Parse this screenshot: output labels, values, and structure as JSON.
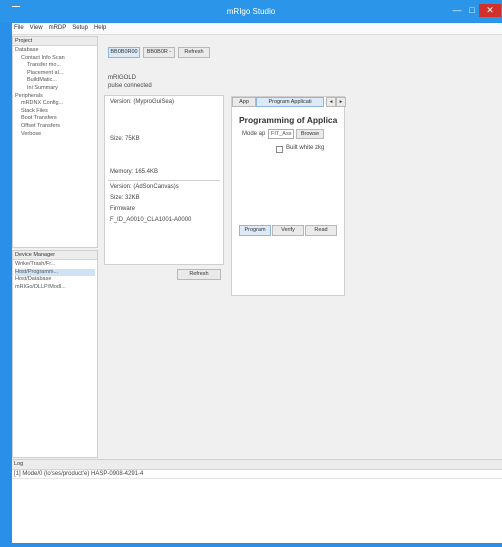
{
  "window": {
    "title": "mRIgo Studio"
  },
  "menubar": {
    "items": [
      "File",
      "View",
      "mRDP",
      "Setup",
      "Help"
    ]
  },
  "sidebar": {
    "header": "Project",
    "items": [
      "Database",
      "Contact Info Scan",
      "Transfer mo...",
      "Placement al...",
      "BuildMatic...",
      "Ini Summary",
      "Peripherals",
      "mRDNX Config...",
      "Stack Files",
      "Boot Transfers",
      "Offset Transfers",
      "Verbose"
    ]
  },
  "devlist": {
    "header": "Device Manager",
    "items": [
      "Wrike/Trash/Fr...",
      "Host/Programm...",
      "Host/Database",
      "mRIGo/DLLP/Modl..."
    ]
  },
  "toolbar": {
    "tab_label": "BB0B0R00",
    "tab2_label": "BB0B0R -",
    "refresh_label": "Refresh"
  },
  "info": {
    "line1": "mRIGOLD",
    "line2": "pulse connected"
  },
  "details": {
    "version_label": "Version: (MyproGuiSea)",
    "size_label": "Size: 75KB",
    "memory_label": "Memory: 165.4KB",
    "version2_label": "Version: (AdSonCanvas)s",
    "size2_label": "Size: 32KB",
    "firmware_label": "Firmware",
    "firmware_value": "F_ID_A0010_CLA1001-A0000"
  },
  "refresh2_label": "Refresh",
  "app_panel": {
    "tab1": "App",
    "tab2": "Program Applicati",
    "title": "Programming of Applica",
    "mode_label": "Mode ap",
    "mode_value": "FIT_Ass",
    "browse_label": "Browse",
    "checkbox_label": "Built white zkg",
    "buttons": [
      "Program",
      "Verify",
      "Read"
    ]
  },
  "output": {
    "header": "Log",
    "lines": [
      "[1] Mode/0 (lo'ses/product'e) HASP-0908-4291-4"
    ]
  }
}
